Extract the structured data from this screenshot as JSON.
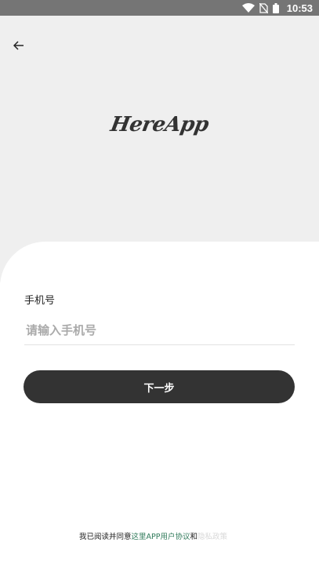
{
  "status_bar": {
    "time": "10:53",
    "icons": [
      "wifi-icon",
      "no-sim-icon",
      "battery-icon"
    ]
  },
  "header": {
    "back_icon": "arrow-left-icon",
    "logo_text": "HereApp"
  },
  "form": {
    "phone_label": "手机号",
    "phone_placeholder": "请输入手机号",
    "phone_value": "",
    "next_button_label": "下一步"
  },
  "agreement": {
    "prefix": "我已阅读并同意",
    "link_text": "这里APP用户协议",
    "and_text": "和",
    "faded_text": "隐私政策"
  },
  "colors": {
    "status_bar_bg": "#757575",
    "header_bg": "#efefef",
    "button_bg": "#333333",
    "link": "#2f7a5a"
  }
}
